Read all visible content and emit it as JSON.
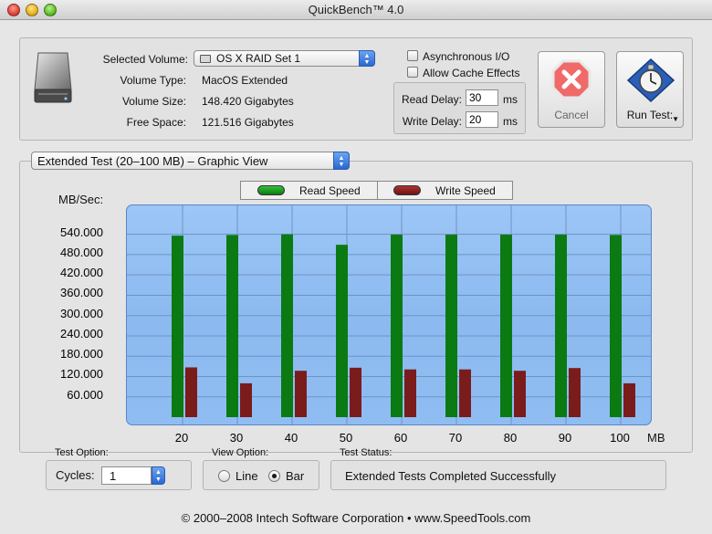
{
  "window": {
    "title": "QuickBench™ 4.0"
  },
  "volume": {
    "selected_label": "Selected Volume:",
    "selected_value": "OS X RAID Set 1",
    "type_label": "Volume Type:",
    "type_value": "MacOS Extended",
    "size_label": "Volume Size:",
    "size_value": "148.420 Gigabytes",
    "free_label": "Free Space:",
    "free_value": "121.516 Gigabytes"
  },
  "options": {
    "async_label": "Asynchronous I/O",
    "async_checked": false,
    "cache_label": "Allow Cache Effects",
    "cache_checked": false,
    "read_delay_label": "Read Delay:",
    "read_delay_value": "30",
    "write_delay_label": "Write Delay:",
    "write_delay_value": "20",
    "unit": "ms"
  },
  "buttons": {
    "cancel_label": "Cancel",
    "run_label": "Run Test:"
  },
  "view_select": {
    "value": "Extended Test (20–100 MB) – Graphic View"
  },
  "legend": {
    "read_label": "Read Speed",
    "write_label": "Write Speed"
  },
  "colors": {
    "read": "#0b7a12",
    "write": "#7a1c1c",
    "plot_bg": "#94c0f3",
    "accent": "#2a67d0"
  },
  "chart_data": {
    "type": "bar",
    "ylabel": "MB/Sec:",
    "xlabel": "MB",
    "categories": [
      "20",
      "30",
      "40",
      "50",
      "60",
      "70",
      "80",
      "90",
      "100"
    ],
    "series": [
      {
        "name": "Read Speed",
        "values": [
          536,
          538,
          540,
          509,
          539,
          539,
          539,
          539,
          538
        ]
      },
      {
        "name": "Write Speed",
        "values": [
          147,
          100,
          137,
          146,
          141,
          141,
          137,
          145,
          100
        ]
      }
    ],
    "yticks": [
      "540.000",
      "480.000",
      "420.000",
      "360.000",
      "300.000",
      "240.000",
      "180.000",
      "120.000",
      "60.000"
    ],
    "ylim": [
      0,
      560
    ],
    "grid": true
  },
  "test_option": {
    "section_label": "Test Option:",
    "cycles_label": "Cycles:",
    "cycles_value": "1"
  },
  "view_option": {
    "section_label": "View Option:",
    "line_label": "Line",
    "bar_label": "Bar",
    "selected": "Bar"
  },
  "status": {
    "section_label": "Test Status:",
    "text": "Extended Tests Completed Successfully"
  },
  "footer": {
    "text": "© 2000–2008 Intech Software Corporation • www.SpeedTools.com"
  }
}
